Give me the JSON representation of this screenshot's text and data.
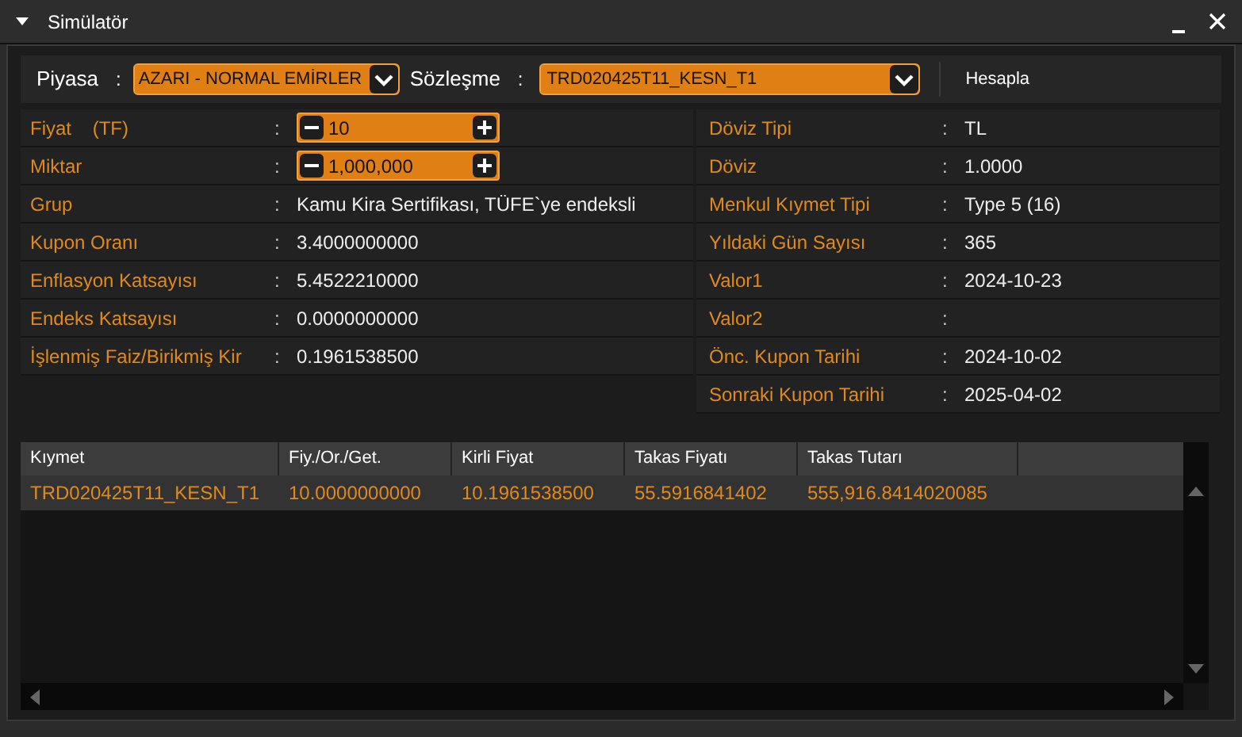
{
  "window": {
    "title": "Simülatör"
  },
  "toolbar": {
    "market_label": "Piyasa",
    "market_separator": ":",
    "market_value": "AZARI - NORMAL EMİRLER",
    "contract_label": "Sözleşme",
    "contract_separator": ":",
    "contract_value": "TRD020425T11_KESN_T1",
    "calculate_button": "Hesapla"
  },
  "left_fields": [
    {
      "kind": "stepper",
      "label": "Fiyat    (TF)",
      "separator": ":",
      "value": "10"
    },
    {
      "kind": "stepper",
      "label": "Miktar",
      "separator": ":",
      "value": "1,000,000"
    },
    {
      "kind": "text",
      "label": "Grup",
      "separator": ":",
      "value": "Kamu Kira Sertifikası, TÜFE`ye endeksli"
    },
    {
      "kind": "text",
      "label": "Kupon Oranı",
      "separator": ":",
      "value": "3.4000000000"
    },
    {
      "kind": "text",
      "label": "Enflasyon Katsayısı",
      "separator": ":",
      "value": "5.4522210000"
    },
    {
      "kind": "text",
      "label": "Endeks Katsayısı",
      "separator": ":",
      "value": "0.0000000000"
    },
    {
      "kind": "text",
      "label": "İşlenmiş Faiz/Birikmiş Kir",
      "separator": ":",
      "value": "0.1961538500"
    }
  ],
  "right_fields": [
    {
      "label": "Döviz Tipi",
      "separator": ":",
      "value": "TL"
    },
    {
      "label": "Döviz",
      "separator": ":",
      "value": "1.0000"
    },
    {
      "label": "Menkul Kıymet Tipi",
      "separator": ":",
      "value": "Type 5 (16)"
    },
    {
      "label": "Yıldaki Gün Sayısı",
      "separator": ":",
      "value": "365"
    },
    {
      "label": "Valor1",
      "separator": ":",
      "value": "2024-10-23"
    },
    {
      "label": "Valor2",
      "separator": ":"
    },
    {
      "label": "Önc. Kupon Tarihi",
      "separator": ":",
      "value": "2024-10-02"
    },
    {
      "label": "Sonraki Kupon Tarihi",
      "separator": ":",
      "value": "2025-04-02"
    }
  ],
  "table": {
    "columns": [
      "Kıymet",
      "Fiy./Or./Get.",
      "Kirli Fiyat",
      "Takas Fiyatı",
      "Takas Tutarı"
    ],
    "rows": [
      {
        "selected": true,
        "cells": [
          "TRD020425T11_KESN_T1",
          "10.0000000000",
          "10.1961538500",
          "55.5916841402",
          "555,916.8414020085"
        ]
      }
    ]
  }
}
